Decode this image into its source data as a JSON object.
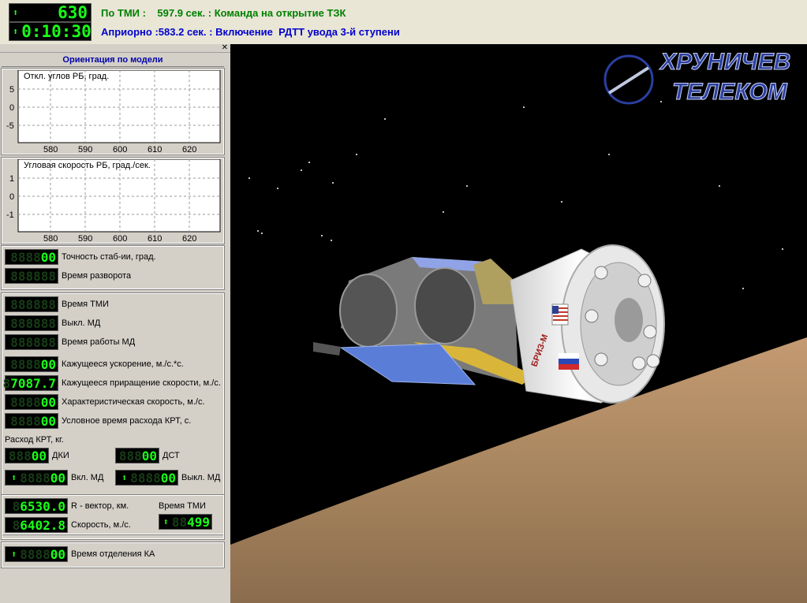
{
  "top": {
    "counter1": "630",
    "counter2": "0:10:30",
    "msg_tmi_label": "По ТМИ :",
    "msg_tmi_time": "597.9 сек. :",
    "msg_tmi_text": "Команда на открытие ТЗК",
    "msg_apr_label": "Априорно :",
    "msg_apr_time": "583.2 сек. :",
    "msg_apr_text": "Включение  РДТТ увода 3-й ступени"
  },
  "left": {
    "title": "Ориентация по модели",
    "chart1_title": "Откл. углов РБ, град.",
    "chart2_title": "Угловая скорость РБ, град./сек.",
    "chart1_yticks": [
      "5",
      "0",
      "-5"
    ],
    "chart2_yticks": [
      "1",
      "0",
      "-1"
    ],
    "xticks": [
      "580",
      "590",
      "600",
      "610",
      "620"
    ],
    "stab_value": "00",
    "stab_label": "Точность стаб-ии, град.",
    "turn_label": "Время разворота",
    "tmi_label": "Время ТМИ",
    "md_off_label": "Выкл. МД",
    "md_work_label": "Время работы МД",
    "accel_value": "00",
    "accel_label": "Кажущееся ускорение, м./с.*с.",
    "dv_value": "7087.7",
    "dv_label": "Кажущееся приращение скорости, м./с.",
    "char_value": "00",
    "char_label": "Характеристическая скорость, м./с.",
    "cond_value": "00",
    "cond_label": "Условное время расхода КРТ, с.",
    "fuel_title": "Расход КРТ, кг.",
    "dki_value": "00",
    "dki_label": "ДКИ",
    "dst_value": "00",
    "dst_label": "ДСТ",
    "md_on_value": "00",
    "md_on_label": "Вкл. МД",
    "md_off2_value": "00",
    "md_off2_label": "Выкл. МД",
    "r_value": "6530.0",
    "r_label": "R - вектор, км.",
    "v_value": "6402.8",
    "v_label": "Скорость, м./с.",
    "tmi_time_label": "Время ТМИ",
    "tmi_time_value": "499",
    "sep_value": "00",
    "sep_label": "Время отделения КА"
  },
  "scene": {
    "logo_line1": "ХРУНИЧЕВ",
    "logo_line2": "ТЕЛЕКОМ",
    "stage_label": "БРИЗ-М",
    "colors": {
      "sky": "#000000",
      "earth": "#b08a66",
      "panel": "#5a7ed8",
      "gold": "#d9b63a"
    }
  }
}
